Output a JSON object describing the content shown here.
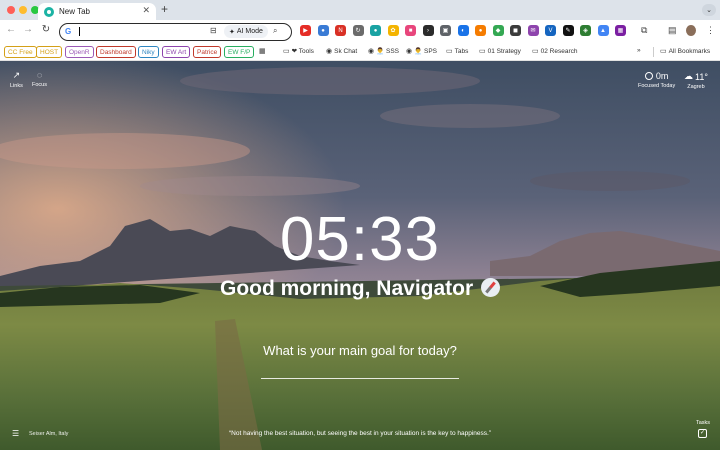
{
  "browser": {
    "tab_title": "New Tab",
    "tab_close": "✕",
    "new_tab": "+",
    "tab_search": "⌄",
    "nav": {
      "back": "←",
      "forward": "→",
      "reload": "↻"
    },
    "omnibox": {
      "value": "",
      "google": "G",
      "ai_mode_label": "AI Mode",
      "ai_mode_icon": "✦"
    },
    "extensions": [
      {
        "icon": "youtube-icon",
        "color": "#e52d27",
        "glyph": "▶"
      },
      {
        "icon": "toggle-extension-icon",
        "color": "#3a7bd5",
        "glyph": "●"
      },
      {
        "icon": "news-extension-icon",
        "color": "#d93025",
        "glyph": "N"
      },
      {
        "icon": "arrow-extension-icon",
        "color": "#6b6b6b",
        "glyph": "↻"
      },
      {
        "icon": "circle-extension-icon",
        "color": "#1aa3a3",
        "glyph": "●"
      },
      {
        "icon": "color-extension-icon",
        "color": "#f4b400",
        "glyph": "✿"
      },
      {
        "icon": "pink-extension-icon",
        "color": "#e8467c",
        "glyph": "■"
      },
      {
        "icon": "terminal-extension-icon",
        "color": "#2b2b2b",
        "glyph": "›"
      },
      {
        "icon": "screen-extension-icon",
        "color": "#5f6368",
        "glyph": "▣"
      },
      {
        "icon": "blue-extension-icon",
        "color": "#1a73e8",
        "glyph": "◐"
      },
      {
        "icon": "orange-extension-icon",
        "color": "#f57c00",
        "glyph": "●"
      },
      {
        "icon": "green-extension-icon",
        "color": "#34a853",
        "glyph": "◆"
      },
      {
        "icon": "dark-extension-icon",
        "color": "#3c3c3c",
        "glyph": "◼"
      },
      {
        "icon": "mail-extension-icon",
        "color": "#8e44ad",
        "glyph": "✉"
      },
      {
        "icon": "v-extension-icon",
        "color": "#1565c0",
        "glyph": "V"
      },
      {
        "icon": "pen-extension-icon",
        "color": "#111111",
        "glyph": "✎"
      },
      {
        "icon": "shield-extension-icon",
        "color": "#2e7d32",
        "glyph": "◈"
      },
      {
        "icon": "gdrive-extension-icon",
        "color": "#4285f4",
        "glyph": "▲"
      },
      {
        "icon": "grid-extension-icon",
        "color": "#7b1fa2",
        "glyph": "▦"
      }
    ],
    "toolbar_right": {
      "puzzle": "⧉",
      "menu": "⋮",
      "cast": "⊟",
      "lens": "⌕",
      "sidebar": "▤",
      "pin": "✎"
    },
    "bookmark_pills": [
      {
        "label": "CC Free",
        "color": "#d4a017"
      },
      {
        "label": "HOST",
        "color": "#d4a017"
      },
      {
        "label": "OpenR",
        "color": "#9b59b6"
      },
      {
        "label": "Dashboard",
        "color": "#c0392b"
      },
      {
        "label": "Niky",
        "color": "#2e86c1"
      },
      {
        "label": "EW Art",
        "color": "#8e44ad"
      },
      {
        "label": "Patrice",
        "color": "#c0392b"
      },
      {
        "label": "EW F/P",
        "color": "#27ae60"
      }
    ],
    "bookmarks": [
      {
        "icon": "▦",
        "label": ""
      },
      {
        "icon": "▭",
        "label": "❤ Tools"
      },
      {
        "icon": "◉",
        "label": "Sk Chat"
      },
      {
        "icon": "◉",
        "label": "👨‍💼 SSS"
      },
      {
        "icon": "◉",
        "label": "👨‍💼 SPS"
      },
      {
        "icon": "▭",
        "label": "Tabs"
      },
      {
        "icon": "▭",
        "label": "01 Strategy"
      },
      {
        "icon": "▭",
        "label": "02 Research"
      }
    ],
    "overflow": "»",
    "all_bookmarks": "All Bookmarks"
  },
  "momentum": {
    "links_label": "Links",
    "focus_label": "Focus",
    "focused_value": "0m",
    "focused_caption": "Focused Today",
    "temperature": "11°",
    "city": "Zagreb",
    "time": "05:33",
    "greeting": "Good morning, Navigator",
    "goal_question": "What is your main goal for today?",
    "goal_value": "",
    "location": "Seiser Alm, Italy",
    "quote": "“Not having the best situation, but seeing the best in your situation is the key to happiness.”",
    "tasks_label": "Tasks",
    "tasks_check": "✓"
  }
}
